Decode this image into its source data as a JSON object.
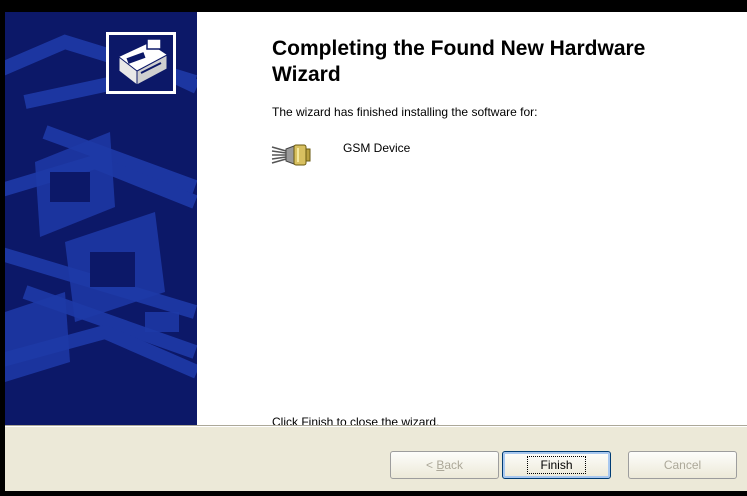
{
  "wizard": {
    "title": "Completing the Found New Hardware Wizard",
    "subtitle": "The wizard has finished installing the software for:",
    "device": {
      "name": "GSM Device",
      "icon": "serial-port-connector-icon"
    },
    "footer": "Click Finish to close the wizard.",
    "banner_icon": "hardware-wizard-icon"
  },
  "buttons": {
    "back_arrow": "<",
    "back_label": "Back",
    "back_accel": "B",
    "back_rest": "ack",
    "finish_label": "Finish",
    "cancel_label": "Cancel"
  },
  "colors": {
    "banner_bg": "#0c1868",
    "banner_art": "#1e3aa8",
    "button_bar": "#ece9d8",
    "disabled_text": "#aca899"
  }
}
